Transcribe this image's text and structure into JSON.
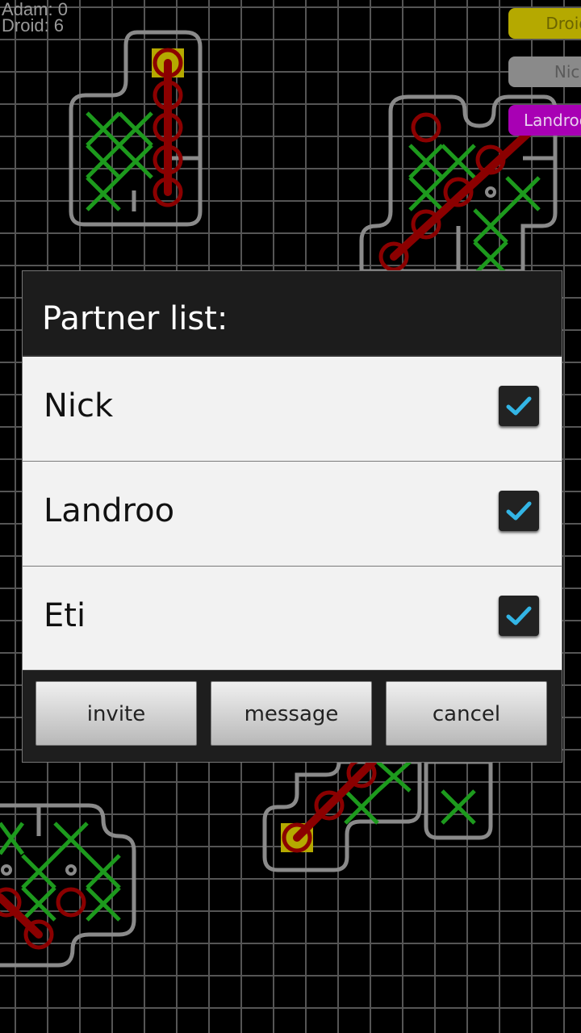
{
  "scoreboard": {
    "line1": "Adam: 0",
    "line2": "Droid: 6"
  },
  "players": [
    {
      "label": "Droid",
      "color": "#b5a900"
    },
    {
      "label": "Nick",
      "color": "#8a8a8a"
    },
    {
      "label": "Landroo",
      "color": "#a800b4"
    }
  ],
  "dialog": {
    "title": "Partner list:",
    "partners": [
      {
        "name": "Nick",
        "checked": true
      },
      {
        "name": "Landroo",
        "checked": true
      },
      {
        "name": "Eti",
        "checked": true
      }
    ],
    "buttons": {
      "invite": "invite",
      "message": "message",
      "cancel": "cancel"
    }
  },
  "colors": {
    "board_background": "#000000",
    "grid_line": "#555555",
    "region_outline": "#8a8a8a",
    "x_mark": "#1d9a1d",
    "o_mark": "#8b0000",
    "winning_line": "#8b0000",
    "yellow_cell": "#b5a900",
    "checkbox_check": "#33b5e5"
  }
}
